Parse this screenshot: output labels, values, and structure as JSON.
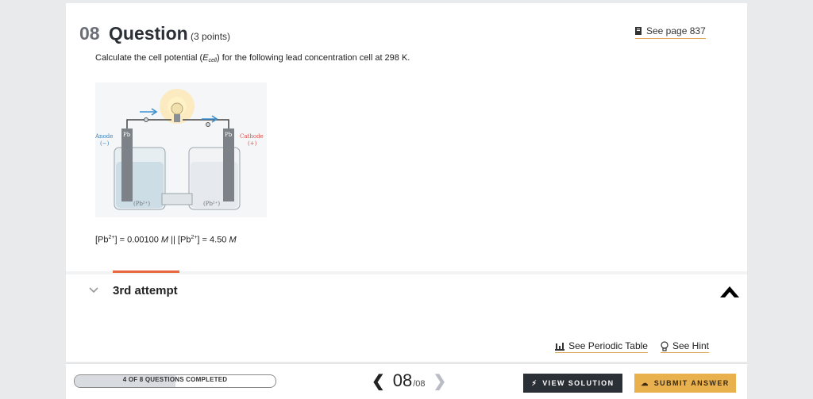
{
  "question": {
    "number": "08",
    "title": "Question",
    "points": "(3 points)",
    "see_page": "See page 837",
    "prompt_pre": "Calculate the cell potential (",
    "prompt_var": "E",
    "prompt_sub": "cell",
    "prompt_post": ") for the following lead concentration cell at 298 K.",
    "figure": {
      "anode_label": "Anode",
      "anode_sign": "(−)",
      "cathode_label": "Cathode",
      "cathode_sign": "(+)",
      "electrode_left": "Pb",
      "electrode_right": "Pb",
      "ion_left": "(Pb²⁺)",
      "ion_right": "(Pb²⁺)"
    },
    "conc_left_pre": "[Pb",
    "conc_left_sup": "2+",
    "conc_left_post": "] = 0.00100 ",
    "conc_unit": "M",
    "conc_sep": " || [Pb",
    "conc_right_sup": "2+",
    "conc_right_post": "] = 4.50 ",
    "conc_unit2": "M"
  },
  "attempt": {
    "title": "3rd attempt",
    "periodic_table": "See Periodic Table",
    "hint": "See Hint"
  },
  "footer": {
    "progress_text": "4 OF 8 QUESTIONS COMPLETED",
    "progress_fraction": 0.5,
    "current": "08",
    "total": "/08",
    "view_solution": "VIEW SOLUTION",
    "submit_answer": "SUBMIT ANSWER"
  },
  "colors": {
    "accent": "#e8673e",
    "submit": "#e9b04e",
    "dark": "#2b2f36"
  }
}
